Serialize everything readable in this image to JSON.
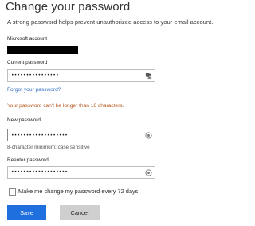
{
  "header": {
    "title": "Change your password",
    "subtitle": "A strong password helps prevent unauthorized access to your email account."
  },
  "account": {
    "label": "Microsoft account"
  },
  "current_password": {
    "label": "Current password",
    "masked_value": "••••••••••••••••",
    "icon": "password-key-icon"
  },
  "forgot_link": "Forgot your password?",
  "error_message": "Your password can't be longer than 16 characters.",
  "new_password": {
    "label": "New password",
    "masked_value": "•••••••••••••••••••",
    "hint": "8-character minimum; case sensitive",
    "icon": "reveal-password-icon"
  },
  "reenter_password": {
    "label": "Reenter password",
    "masked_value": "•••••••••••••••••••",
    "icon": "reveal-password-icon"
  },
  "expire_option": {
    "label": "Make me change my password every 72 days",
    "checked": false
  },
  "buttons": {
    "save": "Save",
    "cancel": "Cancel"
  },
  "colors": {
    "primary_button": "#1f6fde",
    "secondary_button": "#cfcfcf",
    "link": "#2f6fc6",
    "error": "#b5561b"
  }
}
